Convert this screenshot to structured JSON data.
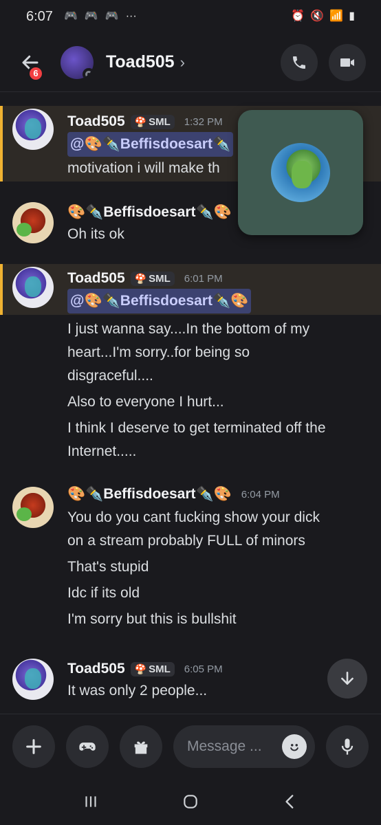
{
  "status_bar": {
    "time": "6:07",
    "left_glyphs": [
      "discord-icon",
      "discord-icon",
      "discord-icon",
      "more-icon"
    ],
    "right_glyphs": [
      "alarm-icon",
      "mute-icon",
      "wifi-icon",
      "signal-icon",
      "battery-icon"
    ]
  },
  "header": {
    "back_badge": "6",
    "title": "Toad505",
    "chevron": "›"
  },
  "messages": [
    {
      "user": "Toad505",
      "tag": "SML",
      "time": "1:32 PM",
      "mention": "@🎨✒️Beffisdoesart✒️",
      "lines": [
        "motivation i will make th"
      ]
    },
    {
      "user": "🎨✒️Beffisdoesart✒️🎨",
      "lines": [
        "Oh its ok"
      ]
    },
    {
      "user": "Toad505",
      "tag": "SML",
      "time": "6:01 PM",
      "mention": "@🎨✒️Beffisdoesart✒️🎨",
      "paragraphs": [
        [
          "I just wanna say....In the bottom of my",
          "heart...I'm sorry..for being so",
          "disgraceful...."
        ],
        [
          "Also to everyone I hurt..."
        ],
        [
          "I think I deserve to get terminated off the",
          "Internet....."
        ]
      ]
    },
    {
      "user": "🎨✒️Beffisdoesart✒️🎨",
      "time": "6:04 PM",
      "paragraphs": [
        [
          "You do you cant fucking show your dick",
          "on a stream probably FULL of minors"
        ],
        [
          "That's stupid"
        ],
        [
          "Idc if its old"
        ],
        [
          "I'm sorry but this is bullshit"
        ]
      ]
    },
    {
      "user": "Toad505",
      "tag": "SML",
      "time": "6:05 PM",
      "lines": [
        "It was only 2 people..."
      ]
    }
  ],
  "composer": {
    "placeholder": "Message ..."
  },
  "colors": {
    "background": "#1a1a1e",
    "highlight_border": "#f0b232",
    "mention_bg": "#3c4270",
    "badge": "#f23f42"
  }
}
